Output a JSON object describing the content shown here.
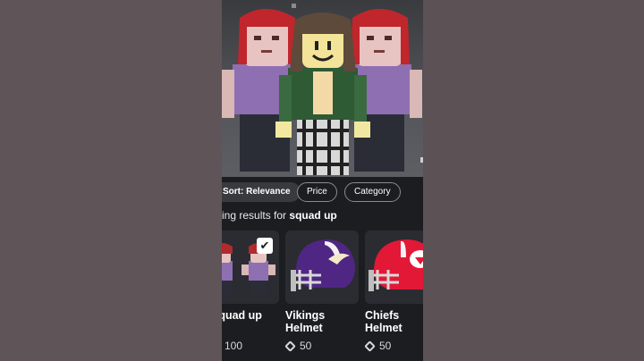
{
  "filters": {
    "sort_label": "Sort: Relevance",
    "price_label": "Price",
    "category_label": "Category"
  },
  "results": {
    "prefix": "Showing results for",
    "query": "squad up"
  },
  "items": [
    {
      "name": "Squad up",
      "price": "100",
      "selected": true
    },
    {
      "name": "Vikings Helmet",
      "price": "50",
      "selected": false
    },
    {
      "name": "Chiefs Helmet",
      "price": "50",
      "selected": false
    }
  ],
  "colors": {
    "background": "#1c1d21",
    "chip_active": "#393a3f",
    "card": "#2b2c31",
    "text": "#ffffff",
    "vikings_purple": "#4f2683",
    "chiefs_red": "#e31837"
  },
  "icons": [
    "checkmark-icon",
    "robux-icon"
  ]
}
